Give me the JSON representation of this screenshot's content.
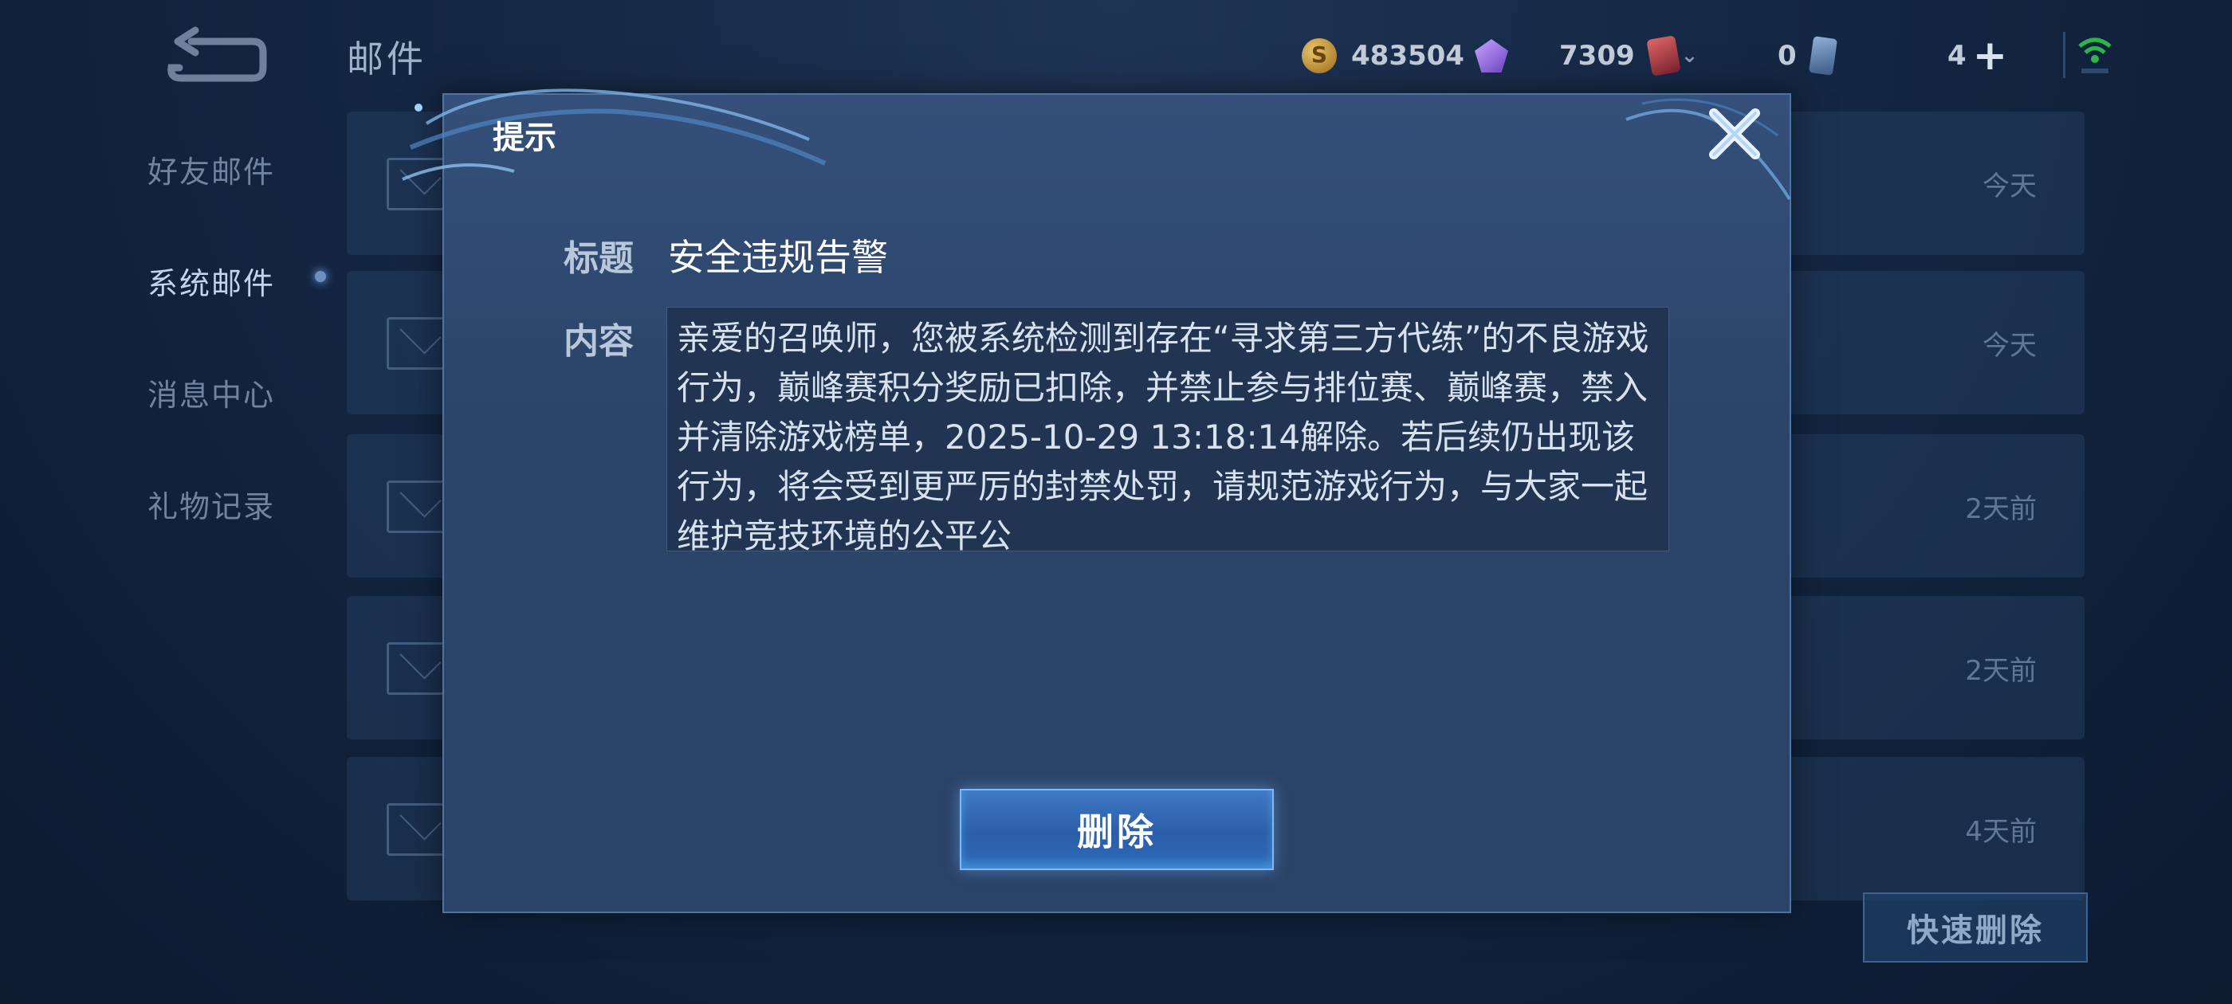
{
  "header": {
    "title": "邮件",
    "gold": "483504",
    "gems": "7309",
    "cards": "0",
    "plus_count": "4"
  },
  "sidebar": {
    "items": [
      {
        "label": "好友邮件"
      },
      {
        "label": "系统邮件"
      },
      {
        "label": "消息中心"
      },
      {
        "label": "礼物记录"
      }
    ]
  },
  "mail_list": {
    "rows": [
      {
        "date": "今天"
      },
      {
        "date": "今天"
      },
      {
        "date": "2天前"
      },
      {
        "date": "2天前"
      },
      {
        "date": "4天前"
      }
    ]
  },
  "quick_delete_label": "快速删除",
  "modal": {
    "title": "提示",
    "subject_label": "标题",
    "subject": "安全违规告警",
    "content_label": "内容",
    "content": "亲爱的召唤师，您被系统检测到存在“寻求第三方代练”的不良游戏行为，巅峰赛积分奖励已扣除，并禁止参与排位赛、巅峰赛，禁入并清除游戏榜单，2025-10-29 13:18:14解除。若后续仍出现该行为，将会受到更严厉的封禁处罚，请规范游戏行为，与大家一起维护竞技环境的公平公",
    "delete_label": "删除"
  },
  "icons": {
    "back": "back-arrow-icon",
    "gold": "gold-coin-icon",
    "gem": "diamond-icon",
    "ticket": "ticket-icon",
    "card": "card-icon",
    "add": "plus-icon",
    "wifi": "wifi-icon",
    "close": "close-icon",
    "mail": "envelope-icon"
  }
}
